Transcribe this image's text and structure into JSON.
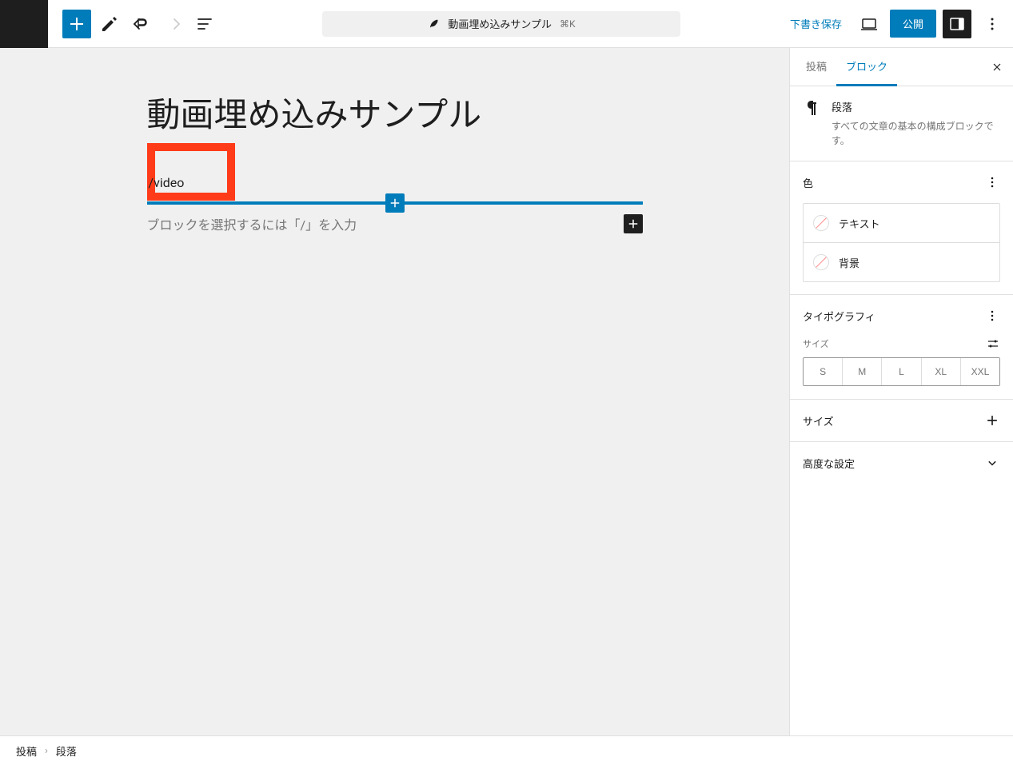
{
  "toolbar": {
    "title_bar_text": "動画埋め込みサンプル",
    "shortcut": "⌘K",
    "draft_save": "下書き保存",
    "publish": "公開"
  },
  "editor": {
    "post_title": "動画埋め込みサンプル",
    "block_input": "/video",
    "placeholder_hint": "ブロックを選択するには「/」を入力"
  },
  "sidebar": {
    "tabs": {
      "post": "投稿",
      "block": "ブロック"
    },
    "block_info": {
      "title": "段落",
      "description": "すべての文章の基本の構成ブロックです。"
    },
    "panels": {
      "color": {
        "title": "色",
        "text_label": "テキスト",
        "bg_label": "背景"
      },
      "typography": {
        "title": "タイポグラフィ",
        "size_label": "サイズ",
        "sizes": [
          "S",
          "M",
          "L",
          "XL",
          "XXL"
        ]
      },
      "size": {
        "title": "サイズ"
      },
      "advanced": {
        "title": "高度な設定"
      }
    }
  },
  "footer": {
    "crumb1": "投稿",
    "crumb2": "段落"
  }
}
